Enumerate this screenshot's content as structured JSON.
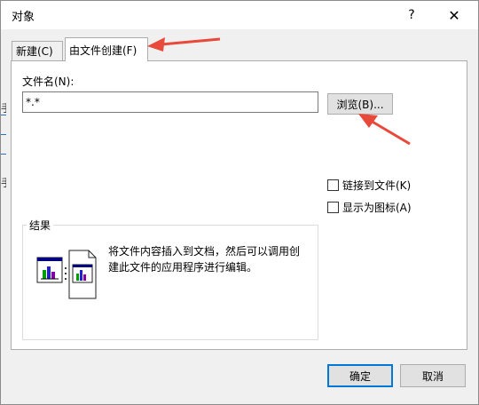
{
  "dialog": {
    "title": "对象",
    "help_label": "?",
    "close_label": "✕"
  },
  "tabs": [
    {
      "label": "新建(C)",
      "active": false
    },
    {
      "label": "由文件创建(F)",
      "active": true
    }
  ],
  "file_panel": {
    "filename_label": "文件名(N):",
    "filename_value": "*.*",
    "browse_label": "浏览(B)...",
    "link_to_file_label": "链接到文件(K)",
    "display_as_icon_label": "显示为图标(A)",
    "result_legend": "结果",
    "result_text": "将文件内容插入到文档，然后可以调用创建此文件的应用程序进行编辑。"
  },
  "footer": {
    "ok_label": "确定",
    "cancel_label": "取消"
  },
  "background": {
    "left_edge_chars": [
      "手",
      "手"
    ]
  },
  "colors": {
    "accent": "#0078d7",
    "annotation_arrow": "#e8493a"
  },
  "icons": {
    "help": "question-mark-icon",
    "close": "close-icon",
    "result": "document-insert-icon"
  }
}
